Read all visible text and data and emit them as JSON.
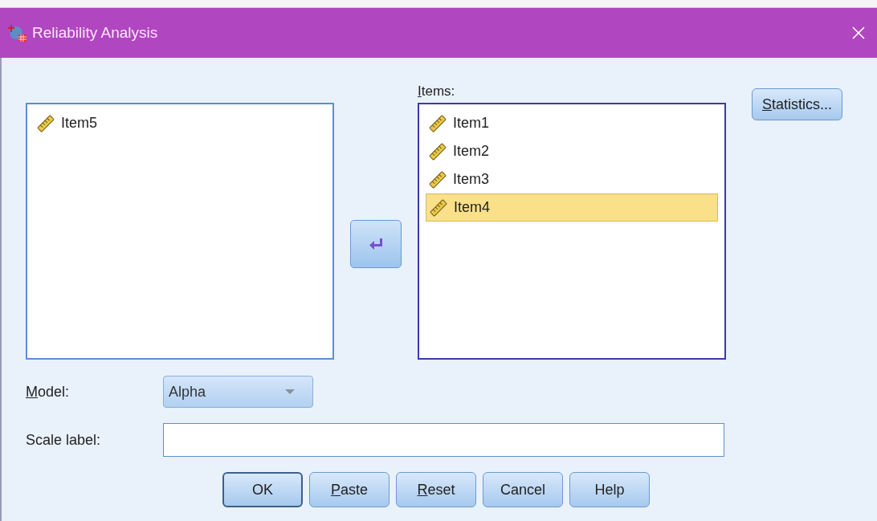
{
  "window": {
    "title": "Reliability Analysis"
  },
  "available": {
    "items": [
      {
        "label": "Item5",
        "selected": false
      }
    ]
  },
  "items": {
    "label": "Items:",
    "first_letter_underlined": true,
    "items": [
      {
        "label": "Item1",
        "selected": false
      },
      {
        "label": "Item2",
        "selected": false
      },
      {
        "label": "Item3",
        "selected": false
      },
      {
        "label": "Item4",
        "selected": true
      }
    ]
  },
  "statistics_button": {
    "label": "Statistics...",
    "first_letter_underlined": true
  },
  "model": {
    "label": "Model:",
    "first_letter_underlined": true,
    "value": "Alpha"
  },
  "scale_label": {
    "label": "Scale label:"
  },
  "buttons": [
    {
      "label": "OK",
      "first_letter_underlined": false,
      "default": true
    },
    {
      "label": "Paste",
      "first_letter_underlined": true,
      "default": false
    },
    {
      "label": "Reset",
      "first_letter_underlined": true,
      "default": false
    },
    {
      "label": "Cancel",
      "first_letter_underlined": false,
      "default": false
    },
    {
      "label": "Help",
      "first_letter_underlined": false,
      "default": false
    }
  ]
}
